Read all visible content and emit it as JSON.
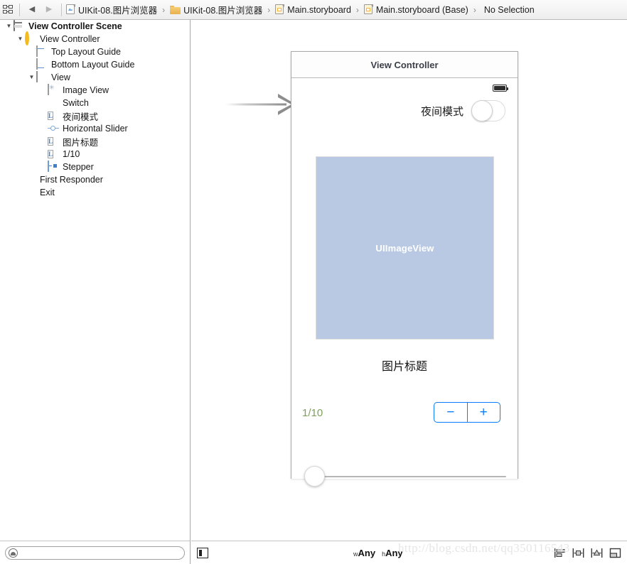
{
  "jump_bar": {
    "related_items_icon": "grid-icon",
    "back_icon": "back-arrow-icon",
    "forward_icon": "forward-arrow-icon",
    "breadcrumbs": [
      {
        "label": "UIKit-08.图片浏览器",
        "icon": "project-icon"
      },
      {
        "label": "UIKit-08.图片浏览器",
        "icon": "folder-icon"
      },
      {
        "label": "Main.storyboard",
        "icon": "storyboard-icon"
      },
      {
        "label": "Main.storyboard (Base)",
        "icon": "storyboard-icon"
      },
      {
        "label": "No Selection",
        "icon": "none"
      }
    ],
    "separator": "›"
  },
  "outline": {
    "items": [
      {
        "label": "View Controller Scene",
        "icon": "scene-icon",
        "depth": 0,
        "disclosure": "▼",
        "bold": true
      },
      {
        "label": "View Controller",
        "icon": "view-controller-icon",
        "depth": 1,
        "disclosure": "▼",
        "bold": false
      },
      {
        "label": "Top Layout Guide",
        "icon": "top-layout-guide-icon",
        "depth": 2,
        "disclosure": "",
        "bold": false
      },
      {
        "label": "Bottom Layout Guide",
        "icon": "bottom-layout-guide-icon",
        "depth": 2,
        "disclosure": "",
        "bold": false
      },
      {
        "label": "View",
        "icon": "view-icon",
        "depth": 2,
        "disclosure": "▼",
        "bold": false
      },
      {
        "label": "Image View",
        "icon": "image-view-icon",
        "depth": 3,
        "disclosure": "",
        "bold": false
      },
      {
        "label": "Switch",
        "icon": "switch-icon",
        "depth": 3,
        "disclosure": "",
        "bold": false
      },
      {
        "label": "夜间模式",
        "icon": "label-icon",
        "depth": 3,
        "disclosure": "",
        "bold": false
      },
      {
        "label": "Horizontal Slider",
        "icon": "slider-icon",
        "depth": 3,
        "disclosure": "",
        "bold": false
      },
      {
        "label": "图片标题",
        "icon": "label-icon",
        "depth": 3,
        "disclosure": "",
        "bold": false
      },
      {
        "label": "1/10",
        "icon": "label-icon",
        "depth": 3,
        "disclosure": "",
        "bold": false
      },
      {
        "label": "Stepper",
        "icon": "stepper-icon",
        "depth": 3,
        "disclosure": "",
        "bold": false
      },
      {
        "label": "First Responder",
        "icon": "first-responder-icon",
        "depth": 1,
        "disclosure": "",
        "bold": false
      },
      {
        "label": "Exit",
        "icon": "exit-icon",
        "depth": 1,
        "disclosure": "",
        "bold": false
      }
    ],
    "filter": {
      "value": "",
      "placeholder": ""
    }
  },
  "canvas": {
    "scene_title": "View Controller",
    "entry_arrow": "initial-view-controller-arrow",
    "status_bar": {
      "battery_icon": "battery-icon"
    },
    "night_mode": {
      "label": "夜间模式",
      "switch_state": "off"
    },
    "image_view": {
      "placeholder_text": "UIImageView",
      "fill_color": "#b9c9e3"
    },
    "caption": "图片标题",
    "counter": {
      "text": "1/10",
      "color": "#7fa060"
    },
    "stepper": {
      "decrement_label": "−",
      "increment_label": "+",
      "tint_color": "#0b7cfb"
    },
    "slider": {
      "value_position_percent": 0
    }
  },
  "footer": {
    "doc_outline_toggle": "document-outline-toggle-icon",
    "size_class": {
      "width_prefix": "w",
      "width_value": "Any",
      "height_prefix": "h",
      "height_value": "Any"
    },
    "tools": [
      {
        "icon": "align-icon"
      },
      {
        "icon": "pin-icon"
      },
      {
        "icon": "resolve-auto-layout-icon"
      },
      {
        "icon": "embed-in-icon"
      }
    ]
  },
  "watermark": "http://blog.csdn.net/qq350116543"
}
